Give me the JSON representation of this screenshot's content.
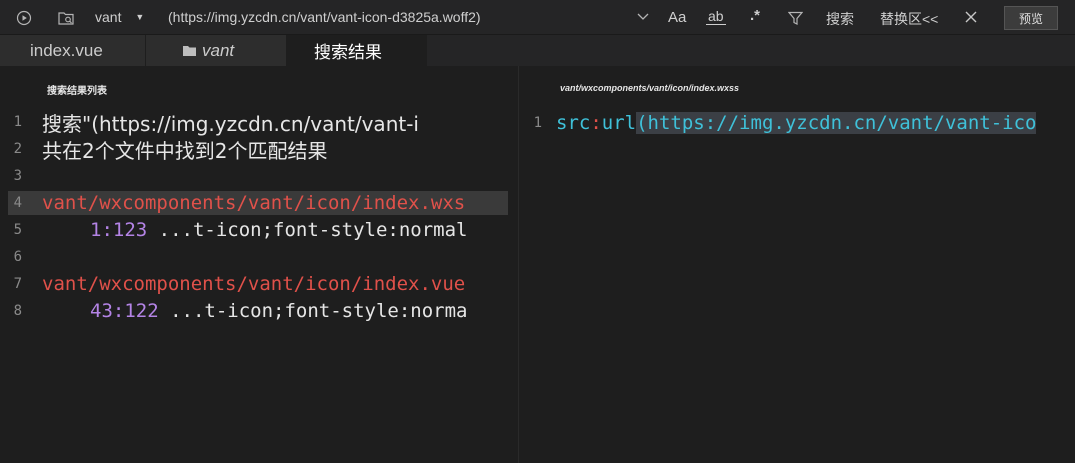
{
  "toolbar": {
    "project": "vant",
    "search_query": "(https://img.yzcdn.cn/vant/vant-icon-d3825a.woff2)",
    "case_label": "Aa",
    "word_label": "ab",
    "regex_label": ".*",
    "search_label": "搜索",
    "replace_label": "替换区<<",
    "preview_label": "预览"
  },
  "tabs": [
    {
      "label": "index.vue"
    },
    {
      "label": "vant"
    },
    {
      "label": "搜索结果"
    }
  ],
  "left_panel": {
    "title": "搜索结果列表",
    "lines": [
      {
        "num": "1",
        "text": "搜索\"(https://img.yzcdn.cn/vant/vant-i"
      },
      {
        "num": "2",
        "text": "共在2个文件中找到2个匹配结果"
      },
      {
        "num": "3",
        "text": ""
      },
      {
        "num": "4",
        "text": "vant/wxcomponents/vant/icon/index.wxs"
      },
      {
        "num": "5",
        "pos": "1:123",
        "text": " ...t-icon;font-style:normal"
      },
      {
        "num": "6",
        "text": ""
      },
      {
        "num": "7",
        "text": "vant/wxcomponents/vant/icon/index.vue"
      },
      {
        "num": "8",
        "pos": "43:122",
        "text": " ...t-icon;font-style:norma"
      }
    ]
  },
  "right_panel": {
    "title": "vant/wxcomponents/vant/icon/index.wxss",
    "line_num": "1",
    "prop": "src",
    "colon": ":",
    "func": "url",
    "arg": "(https://img.yzcdn.cn/vant/vant-ico"
  }
}
